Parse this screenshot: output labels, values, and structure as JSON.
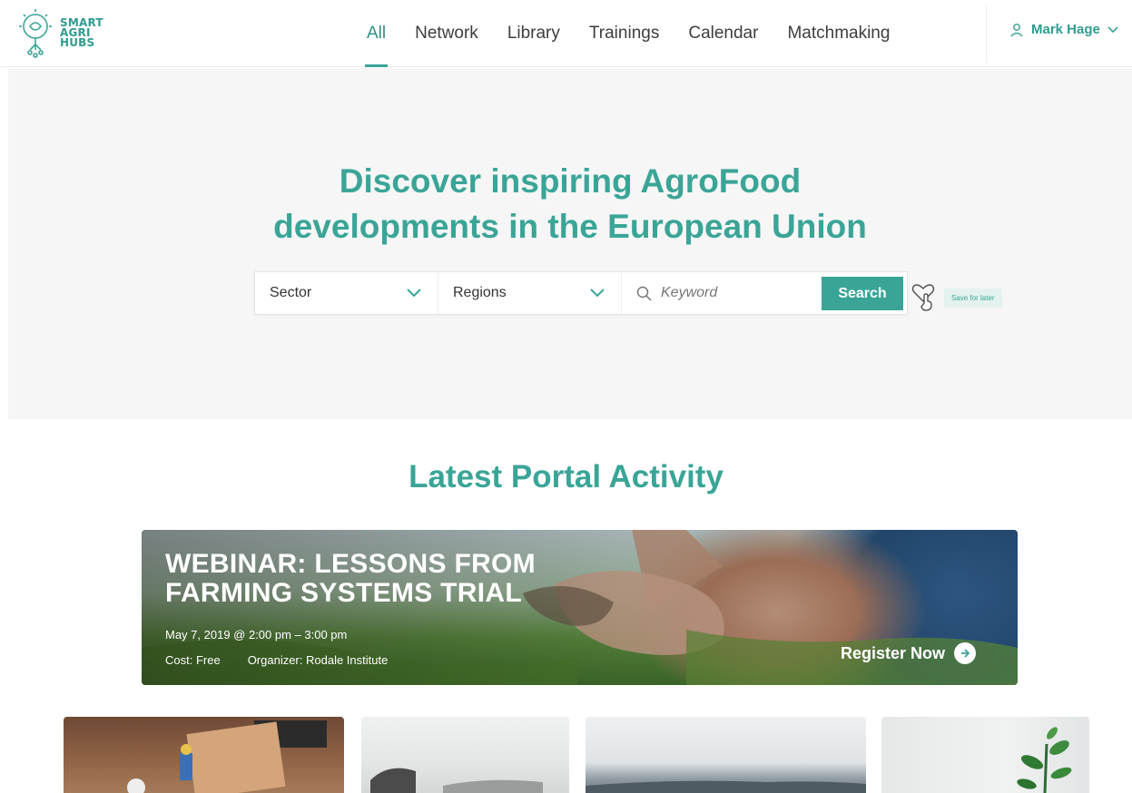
{
  "header": {
    "logo_lines": [
      "SMART",
      "AGRI",
      "HUBS"
    ],
    "nav": [
      {
        "label": "All",
        "active": true
      },
      {
        "label": "Network",
        "active": false
      },
      {
        "label": "Library",
        "active": false
      },
      {
        "label": "Trainings",
        "active": false
      },
      {
        "label": "Calendar",
        "active": false
      },
      {
        "label": "Matchmaking",
        "active": false
      }
    ],
    "user_name": "Mark Hage",
    "user_icon": "user-icon",
    "chevron_icon": "chevron-down-icon"
  },
  "hero": {
    "title_line1": "Discover inspiring AgroFood",
    "title_line2": "developments in the European Union",
    "sector_label": "Sector",
    "regions_label": "Regions",
    "keyword_placeholder": "Keyword",
    "search_label": "Search",
    "save_label": "Save for later"
  },
  "latest": {
    "title": "Latest Portal Activity",
    "banner": {
      "title_line1": "WEBINAR: LESSONS FROM",
      "title_line2": "FARMING SYSTEMS TRIAL",
      "date": "May 7, 2019 @ 2:00 pm – 3:00 pm",
      "cost": "Cost: Free",
      "organizer": "Organizer: Rodale Institute",
      "cta": "Register Now"
    }
  },
  "colors": {
    "accent": "#3aa597",
    "hero_bg": "#f6f6f6",
    "text": "#3d3d3d"
  }
}
